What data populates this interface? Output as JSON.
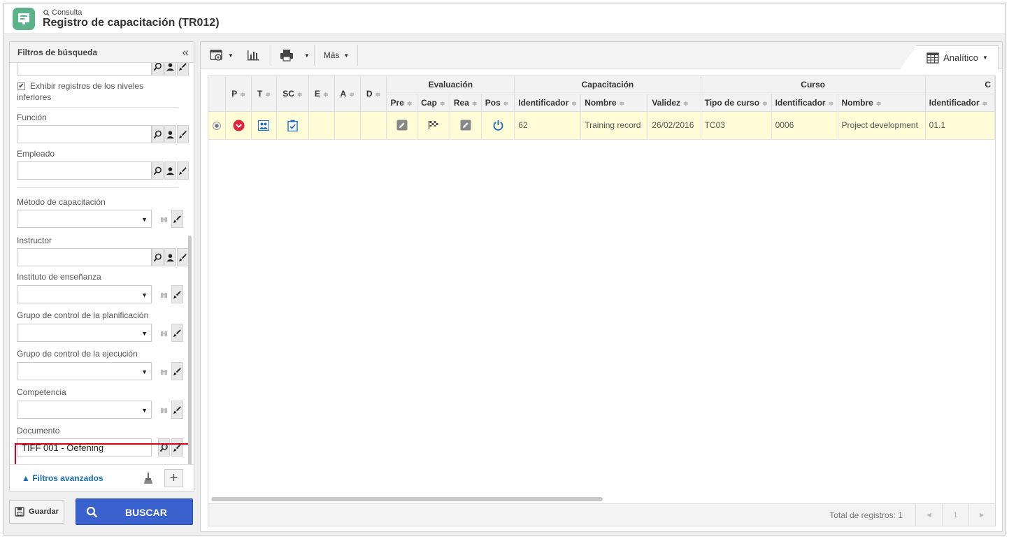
{
  "header": {
    "breadcrumb": "Consulta",
    "title": "Registro de capacitación (TR012)"
  },
  "filters": {
    "panel_title": "Filtros de búsqueda",
    "collapse_glyph": "«",
    "show_lower_levels": "Exhibir registros de los niveles inferiores",
    "show_lower_levels_checked": true,
    "funcion": "Función",
    "empleado": "Empleado",
    "metodo": "Método de capacitación",
    "instructor": "Instructor",
    "instituto": "Instituto de enseñanza",
    "grupo_planificacion": "Grupo de control de la planificación",
    "grupo_ejecucion": "Grupo de control de la ejecución",
    "competencia": "Competencia",
    "documento": "Documento",
    "documento_value": "TIFF 001 - Oefening",
    "advanced": "Filtros avanzados",
    "add_glyph": "+"
  },
  "actions": {
    "save": "Guardar",
    "search": "BUSCAR"
  },
  "toolbar": {
    "more": "Más",
    "view": "Analítico"
  },
  "table": {
    "group_headers": [
      "Evaluación",
      "Capacitación",
      "Curso",
      "C"
    ],
    "columns": [
      "P",
      "T",
      "SC",
      "E",
      "A",
      "D",
      "Pre",
      "Cap",
      "Rea",
      "Pos",
      "Identificador",
      "Nombre",
      "Validez",
      "Tipo de curso",
      "Identificador",
      "Nombre",
      "Identificador"
    ],
    "row": {
      "training_id": "62",
      "training_name": "Training record",
      "validity": "26/02/2016",
      "course_type": "TC03",
      "course_id": "0006",
      "course_name": "Project development",
      "c_id": "01.1"
    }
  },
  "footer": {
    "total": "Total de registros: 1",
    "page": "1",
    "prev": "◄",
    "next": "►"
  },
  "colors": {
    "accent": "#3a62cf",
    "logo": "#5cb38a",
    "highlight": "#d0021b",
    "row_bg": "#fdfcd7",
    "status_red": "#e0243a",
    "icon_blue": "#1d6fc4"
  }
}
